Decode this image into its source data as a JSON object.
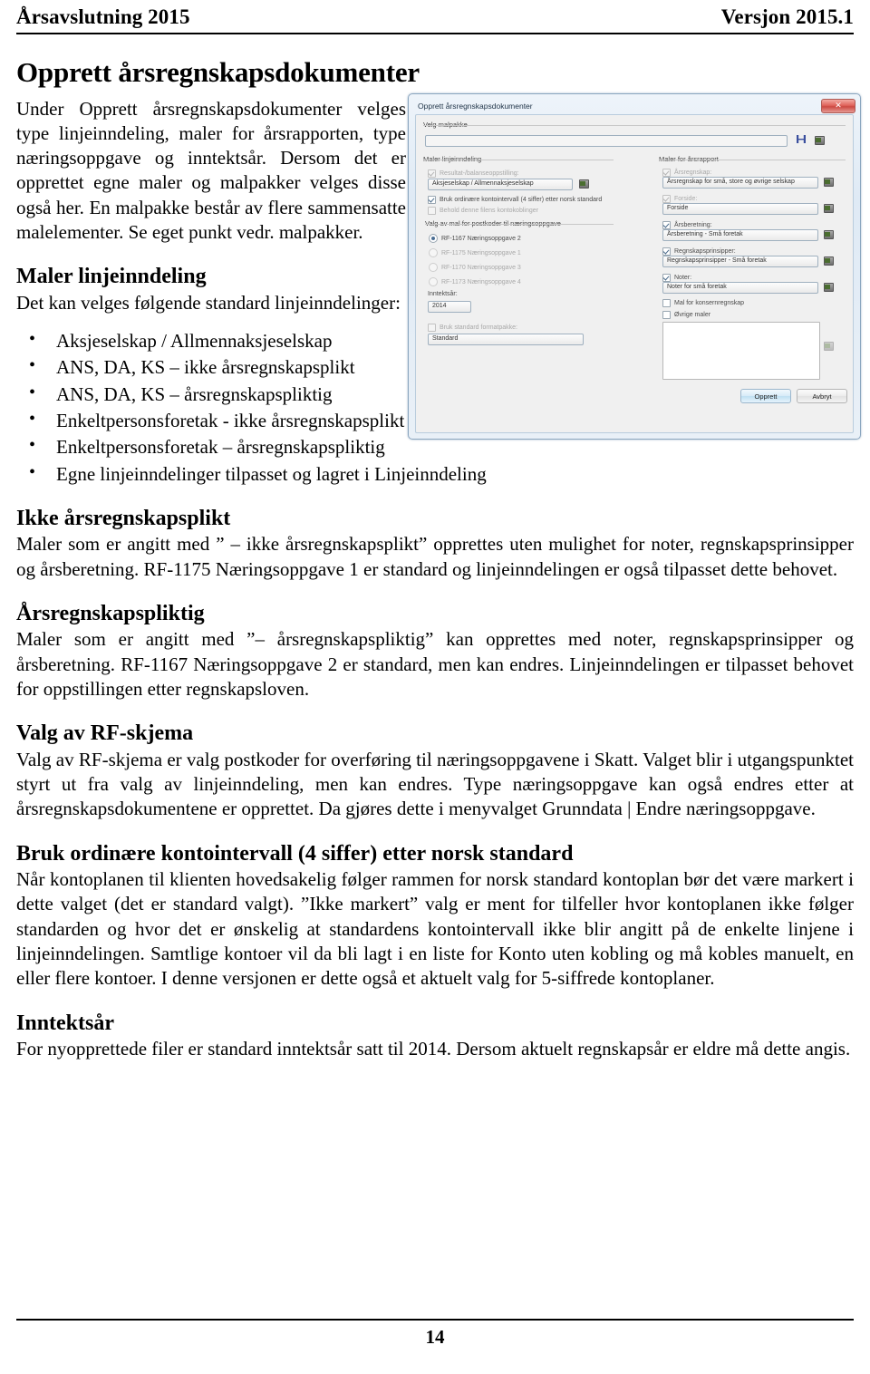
{
  "header": {
    "left": "Årsavslutning 2015",
    "right": "Versjon 2015.1"
  },
  "title": "Opprett årsregnskapsdokumenter",
  "intro": "Under Opprett årsregnskapsdokumenter velges type linjeinndeling, maler for årsrapporten, type næringsoppgave og inntektsår.  Dersom det er opprettet egne maler og malpakker velges disse også her.  En malpakke består av flere sammensatte malelementer.  Se eget punkt vedr. malpakker.",
  "sections": {
    "maler_linjeinndeling": {
      "heading": "Maler linjeinndeling",
      "intro": "Det kan velges følgende standard linjeinndelinger:",
      "bullets": [
        "Aksjeselskap / Allmennaksjeselskap",
        "ANS, DA, KS – ikke årsregnskapsplikt",
        "ANS, DA, KS – årsregnskapspliktig",
        "Enkeltpersonsforetak - ikke årsregnskapsplikt",
        "Enkeltpersonsforetak – årsregnskapspliktig",
        "Egne linjeinndelinger tilpasset og lagret i Linjeinndeling"
      ]
    },
    "ikke_plikt": {
      "heading": "Ikke årsregnskapsplikt",
      "body": "Maler som er angitt med ” – ikke årsregnskapsplikt” opprettes uten mulighet for noter, regnskapsprinsipper og årsberetning.  RF-1175 Næringsoppgave 1 er standard og linjeinndelingen er også tilpasset dette behovet."
    },
    "pliktig": {
      "heading": "Årsregnskapspliktig",
      "body": "Maler som er angitt med ”– årsregnskapspliktig” kan opprettes med noter, regnskapsprinsipper og årsberetning.  RF-1167 Næringsoppgave 2 er standard, men kan endres. Linjeinndelingen er tilpasset behovet for oppstillingen etter regnskapsloven."
    },
    "valg_rf": {
      "heading": "Valg av RF-skjema",
      "body": "Valg av RF-skjema er valg postkoder for overføring til næringsoppgavene i Skatt. Valget blir i utgangspunktet styrt ut fra valg av linjeinndeling, men kan endres. Type næringsoppgave kan også endres etter at årsregnskapsdokumentene er opprettet.  Da gjøres dette i menyvalget Grunndata | Endre næringsoppgave."
    },
    "kontointervall": {
      "heading": "Bruk ordinære kontointervall (4 siffer) etter norsk standard",
      "body": "Når kontoplanen til klienten hovedsakelig følger rammen for norsk standard kontoplan bør det være markert i dette valget (det er standard valgt). ”Ikke markert” valg er ment for tilfeller hvor kontoplanen ikke følger standarden og hvor det er ønskelig at standardens kontointervall ikke blir angitt på de enkelte linjene i linjeinndelingen.  Samtlige kontoer vil da bli lagt i en liste for Konto uten kobling og må kobles manuelt, en eller flere kontoer.  I denne versjonen er dette også et aktuelt valg for 5-siffrede kontoplaner."
    },
    "inntektsaar": {
      "heading": "Inntektsår",
      "body": "For nyopprettede filer er standard inntektsår satt til 2014.  Dersom aktuelt regnskapsår er eldre må dette angis."
    }
  },
  "dialog": {
    "title": "Opprett årsregnskapsdokumenter",
    "close_label": "✕",
    "malpakke": {
      "group_label": "Velg malpakke",
      "combo_value": "",
      "save_icon": "save-icon",
      "browse_icon": "folder-icon"
    },
    "left_panel": {
      "group_label": "Maler linjeinndeling",
      "resultat_checkbox": "Resultat-/balanseoppstilling:",
      "resultat_combo": "Aksjeselskap / Allmennaksjeselskap",
      "kontointervall_checkbox": "Bruk ordinære kontointervall (4 siffer) etter norsk standard",
      "behold_checkbox": "Behold denne filens kontokoblinger",
      "postkoder_group": "Valg av mal for postkoder til næringsoppgave",
      "radios": [
        "RF-1167 Næringsoppgave 2",
        "RF-1175 Næringsoppgave 1",
        "RF-1170 Næringsoppgave 3",
        "RF-1173 Næringsoppgave 4"
      ],
      "selected_radio_index": 0,
      "inntektsaar_label": "Inntektsår:",
      "inntektsaar_value": "2014",
      "formatpakke_checkbox": "Bruk standard formatpakke:",
      "formatpakke_combo": "Standard"
    },
    "right_panel": {
      "group_label": "Maler for årsrapport",
      "rows": [
        {
          "checkbox": "Årsregnskap:",
          "combo": "Årsregnskap for små, store og øvrige selskap",
          "checked": true,
          "dim": true
        },
        {
          "checkbox": "Forside:",
          "combo": "Forside",
          "checked": true,
          "dim": true
        },
        {
          "checkbox": "Årsberetning:",
          "combo": "Årsberetning - Små foretak",
          "checked": true,
          "dim": false
        },
        {
          "checkbox": "Regnskapsprinsipper:",
          "combo": "Regnskapsprinsipper - Små foretak",
          "checked": true,
          "dim": false
        },
        {
          "checkbox": "Noter:",
          "combo": "Noter for små foretak",
          "checked": true,
          "dim": false
        }
      ],
      "konsern_checkbox": "Mal for konsernregnskap",
      "ovrige_checkbox": "Øvrige maler"
    },
    "buttons": {
      "primary": "Opprett",
      "secondary": "Avbryt"
    }
  },
  "footer": {
    "page_number": "14"
  }
}
